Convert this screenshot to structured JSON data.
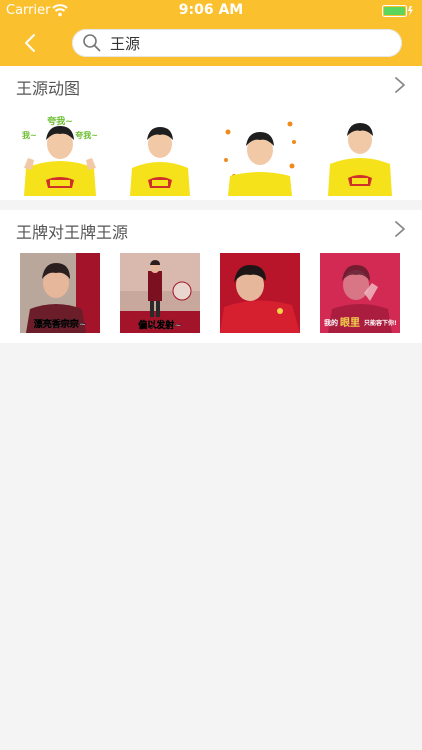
{
  "status_bar": {
    "carrier": "Carrier",
    "time": "9:06 AM"
  },
  "search": {
    "value": "王源"
  },
  "sections": [
    {
      "title": "王源动图",
      "items": [
        {
          "caption_top": "夸我~",
          "caption_left": "我~",
          "caption_right": "夸我~"
        },
        {},
        {},
        {}
      ]
    },
    {
      "title": "王牌对王牌王源",
      "items": [
        {
          "caption": "漂亮香宗宗~"
        },
        {
          "caption": "偏以发射~"
        },
        {
          "caption": ""
        },
        {
          "caption_a": "我的",
          "caption_b": "眼里",
          "caption_c": "只能容下你!"
        }
      ]
    }
  ],
  "colors": {
    "accent": "#fbc02d",
    "hoodie": "#f5e21a",
    "red": "#c8102e"
  }
}
